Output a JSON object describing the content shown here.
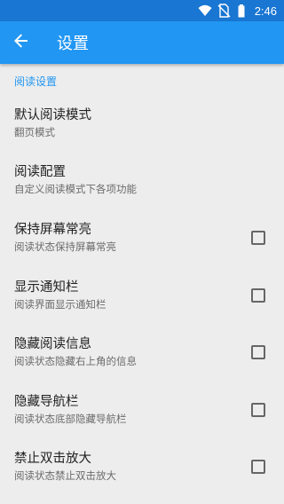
{
  "status_bar": {
    "time": "2:46",
    "icons": [
      "wifi-icon",
      "no-sim-icon",
      "battery-icon"
    ]
  },
  "app_bar": {
    "title": "设置",
    "back_icon": "arrow-back-icon",
    "color": "#2196f3"
  },
  "section": {
    "header": "阅读设置",
    "color": "#2196f3"
  },
  "preferences": [
    {
      "title": "默认阅读模式",
      "summary": "翻页模式",
      "checkbox": false
    },
    {
      "title": "阅读配置",
      "summary": "自定义阅读模式下各项功能",
      "checkbox": false
    },
    {
      "title": "保持屏幕常亮",
      "summary": "阅读状态保持屏幕常亮",
      "checkbox": true,
      "checked": false
    },
    {
      "title": "显示通知栏",
      "summary": "阅读界面显示通知栏",
      "checkbox": true,
      "checked": false
    },
    {
      "title": "隐藏阅读信息",
      "summary": "阅读状态隐藏右上角的信息",
      "checkbox": true,
      "checked": false
    },
    {
      "title": "隐藏导航栏",
      "summary": "阅读状态底部隐藏导航栏",
      "checkbox": true,
      "checked": false
    },
    {
      "title": "禁止双击放大",
      "summary": "阅读状态禁止双击放大",
      "checkbox": true,
      "checked": false
    }
  ]
}
